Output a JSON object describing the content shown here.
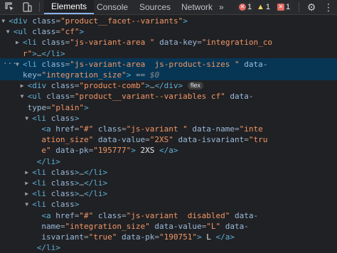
{
  "toolbar": {
    "tabs": [
      "Elements",
      "Console",
      "Sources",
      "Network"
    ],
    "active_tab": "Elements",
    "issues_count": "1",
    "warnings_count": "1",
    "errors_count": "1"
  },
  "dom_lines": [
    {
      "indent": 17,
      "arrow": "▼",
      "html": "<span class='tag'>&lt;div</span> <span class='attr'>class</span><span class='eq'>=</span><span class='val'>\"product__facet--variants\"</span><span class='tag'>&gt;</span>"
    },
    {
      "indent": 18,
      "arrow": "▼",
      "html": "<span class='tag'>&lt;ul</span> <span class='attr'>class</span><span class='eq'>=</span><span class='val'>\"cf\"</span><span class='tag'>&gt;</span>"
    },
    {
      "indent": 20,
      "arrow": "▶",
      "html": "<span class='tag'>&lt;li</span> <span class='attr'>class</span><span class='eq'>=</span><span class='val'>\"js-variant-area \"</span> <span class='attr'>data-key</span><span class='eq'>=</span><span class='val'>\"integration_co</span>"
    },
    {
      "indent": 20,
      "arrow": "",
      "html": "<span class='val'>r\"</span><span class='tag'>&gt;</span>…<span class='tag'>&lt;/li&gt;</span>"
    },
    {
      "indent": 20,
      "arrow": "▼",
      "html": "<span class='tag'>&lt;li</span> <span class='attr'>class</span><span class='eq'>=</span><span class='val'>\"js-variant-area  js-product-sizes \"</span> <span class='attr'>data-</span>"
    },
    {
      "indent": 20,
      "arrow": "",
      "html": "<span class='attr'>key</span><span class='eq'>=</span><span class='val'>\"integration_size\"</span><span class='tag'>&gt;</span> <span class='eq'>==</span> <span class='dollar'>$0</span>"
    },
    {
      "indent": 21,
      "arrow": "▶",
      "html": "<span class='tag'>&lt;div</span> <span class='attr'>class</span><span class='eq'>=</span><span class='val'>\"product-comb\"</span><span class='tag'>&gt;</span>…<span class='tag'>&lt;/div&gt;</span> <span class='flex-badge'>flex</span>"
    },
    {
      "indent": 21,
      "arrow": "▼",
      "html": "<span class='tag'>&lt;ul</span> <span class='attr'>class</span><span class='eq'>=</span><span class='val'>\"product__variant--variables cf\"</span> <span class='attr'>data-</span>"
    },
    {
      "indent": 21,
      "arrow": "",
      "html": "<span class='attr'>type</span><span class='eq'>=</span><span class='val'>\"plain\"</span><span class='tag'>&gt;</span>"
    },
    {
      "indent": 22,
      "arrow": "▼",
      "html": "<span class='tag'>&lt;li</span> <span class='attr'>class</span><span class='tag'>&gt;</span>"
    },
    {
      "indent": 24,
      "arrow": "",
      "html": "<span class='tag'>&lt;a</span> <span class='attr'>href</span><span class='eq'>=</span><span class='val'>\"#\"</span> <span class='attr'>class</span><span class='eq'>=</span><span class='val'>\"js-variant \"</span> <span class='attr'>data-name</span><span class='eq'>=</span><span class='val'>\"inte</span>"
    },
    {
      "indent": 24,
      "arrow": "",
      "html": "<span class='val'>ation_size\"</span> <span class='attr'>data-value</span><span class='eq'>=</span><span class='val'>\"2XS\"</span> <span class='attr'>data-isvariant</span><span class='eq'>=</span><span class='val'>\"tru</span>"
    },
    {
      "indent": 24,
      "arrow": "",
      "html": "<span class='val'>e\"</span> <span class='attr'>data-pk</span><span class='eq'>=</span><span class='val'>\"195777\"</span><span class='tag'>&gt;</span> <span class='txt'>2XS</span> <span class='tag'>&lt;/a&gt;</span>"
    },
    {
      "indent": 23,
      "arrow": "",
      "html": "<span class='tag'>&lt;/li&gt;</span>"
    },
    {
      "indent": 22,
      "arrow": "▶",
      "html": "<span class='tag'>&lt;li</span> <span class='attr'>class</span><span class='tag'>&gt;</span>…<span class='tag'>&lt;/li&gt;</span>"
    },
    {
      "indent": 22,
      "arrow": "▶",
      "html": "<span class='tag'>&lt;li</span> <span class='attr'>class</span><span class='tag'>&gt;</span>…<span class='tag'>&lt;/li&gt;</span>"
    },
    {
      "indent": 22,
      "arrow": "▶",
      "html": "<span class='tag'>&lt;li</span> <span class='attr'>class</span><span class='tag'>&gt;</span>…<span class='tag'>&lt;/li&gt;</span>"
    },
    {
      "indent": 22,
      "arrow": "▼",
      "html": "<span class='tag'>&lt;li</span> <span class='attr'>class</span><span class='tag'>&gt;</span>"
    },
    {
      "indent": 24,
      "arrow": "",
      "html": "<span class='tag'>&lt;a</span> <span class='attr'>href</span><span class='eq'>=</span><span class='val'>\"#\"</span> <span class='attr'>class</span><span class='eq'>=</span><span class='val'>\"js-variant  disabled\"</span> <span class='attr'>data-</span>"
    },
    {
      "indent": 24,
      "arrow": "",
      "html": "<span class='attr'>name</span><span class='eq'>=</span><span class='val'>\"integration_size\"</span> <span class='attr'>data-value</span><span class='eq'>=</span><span class='val'>\"L\"</span> <span class='attr'>data-</span>"
    },
    {
      "indent": 24,
      "arrow": "",
      "html": "<span class='attr'>isvariant</span><span class='eq'>=</span><span class='val'>\"true\"</span> <span class='attr'>data-pk</span><span class='eq'>=</span><span class='val'>\"190751\"</span><span class='tag'>&gt;</span> <span class='txt'>L</span> <span class='tag'>&lt;/a&gt;</span>"
    },
    {
      "indent": 23,
      "arrow": "",
      "html": "<span class='tag'>&lt;/li&gt;</span>"
    }
  ],
  "colors": {
    "background": "#202124",
    "selection": "#073655",
    "tag": "#5db0d7",
    "attribute": "#9bbbdc",
    "value": "#f29766"
  },
  "icons": [
    "inspect-element-icon",
    "device-toolbar-icon",
    "settings-gear-icon",
    "more-options-icon",
    "issue-icon",
    "warning-icon",
    "error-icon",
    "ellipsis-icon"
  ]
}
